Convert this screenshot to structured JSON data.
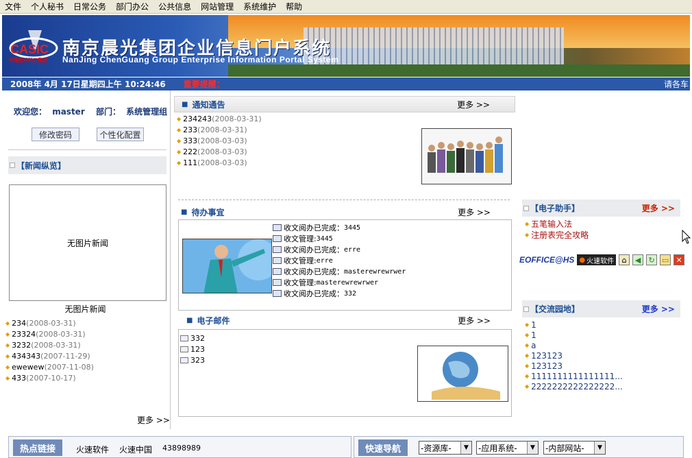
{
  "menubar": {
    "items": [
      "文件",
      "个人秘书",
      "日常公务",
      "部门办公",
      "公共信息",
      "网站管理",
      "系统维护",
      "帮助"
    ],
    "brand": "EOFFICE@HS",
    "brand_logo": "火速软件",
    "icons": [
      "home-icon",
      "back-icon",
      "refresh-icon",
      "folder-icon",
      "close-icon"
    ]
  },
  "banner": {
    "logo_text": "CASIC",
    "logo_sub": "中国航天科工集团",
    "title_cn": "南京晨光集团企业信息门户系统",
    "title_en": "NanJing ChenGuang Group Enterprise Information Portal System"
  },
  "status": {
    "datetime": "2008年 4月 17日星期四上午  10:24:46",
    "alert_label": "重要提醒：",
    "scroll_text": "请各车"
  },
  "left": {
    "welcome_label": "欢迎您：",
    "user": "master",
    "dept_label": "部门：",
    "dept": "系统管理组",
    "change_password": "修改密码",
    "personalize": "个性化配置",
    "news_title": "【新闻纵览】",
    "no_picture_news": "无图片新闻",
    "no_picture_caption": "无图片新闻",
    "news_items": [
      {
        "title": "234",
        "date": "(2008-03-31)"
      },
      {
        "title": "23324",
        "date": "(2008-03-31)"
      },
      {
        "title": "3232",
        "date": "(2008-03-31)"
      },
      {
        "title": "434343",
        "date": "(2007-11-29)"
      },
      {
        "title": "ewewew",
        "date": "(2007-11-08)"
      },
      {
        "title": "433",
        "date": "(2007-10-17)"
      }
    ],
    "more": "更多 >>"
  },
  "notice": {
    "title": "通知通告",
    "more": "更多 >>",
    "items": [
      {
        "title": "234243",
        "date": "(2008-03-31)"
      },
      {
        "title": "233",
        "date": "(2008-03-31)"
      },
      {
        "title": "333",
        "date": "(2008-03-03)"
      },
      {
        "title": "222",
        "date": "(2008-03-03)"
      },
      {
        "title": "111",
        "date": "(2008-03-03)"
      }
    ]
  },
  "todo": {
    "title": "待办事宜",
    "more": "更多 >>",
    "items": [
      {
        "label": "收文阅办已完成：",
        "value": "3445"
      },
      {
        "label": "收文管理:",
        "value": "3445"
      },
      {
        "label": "收文阅办已完成：",
        "value": "erre"
      },
      {
        "label": "收文管理:",
        "value": "erre"
      },
      {
        "label": "收文阅办已完成：",
        "value": "masterewrewrwer"
      },
      {
        "label": "收文管理:",
        "value": "masterewrewrwer"
      },
      {
        "label": "收文阅办已完成：",
        "value": "332"
      }
    ]
  },
  "email": {
    "title": "电子邮件",
    "more": "更多 >>",
    "items": [
      "332",
      "123",
      "323"
    ]
  },
  "assistant": {
    "title": "【电子助手】",
    "more": "更多 >>",
    "items": [
      "五笔输入法",
      "注册表完全攻略"
    ]
  },
  "forum": {
    "title": "【交流园地】",
    "more": "更多 >>",
    "items": [
      "1",
      "1",
      "a",
      "123123",
      "123123",
      "1111111111111111...",
      "2222222222222222..."
    ]
  },
  "bottom": {
    "hot_links_label": "热点链接",
    "links": [
      "火速软件",
      "火速中国",
      "43898989"
    ],
    "quick_nav_label": "快速导航",
    "selects": [
      "-资源库-",
      "-应用系统-",
      "-内部网站-"
    ]
  },
  "colors": {
    "accent": "#1d4e94",
    "status_bar": "#2b58a8",
    "alert": "#ff2a2a",
    "assistant_more": "#cc2200",
    "forum_more": "#1d3bcc",
    "assistant_item": "#aa1111"
  }
}
